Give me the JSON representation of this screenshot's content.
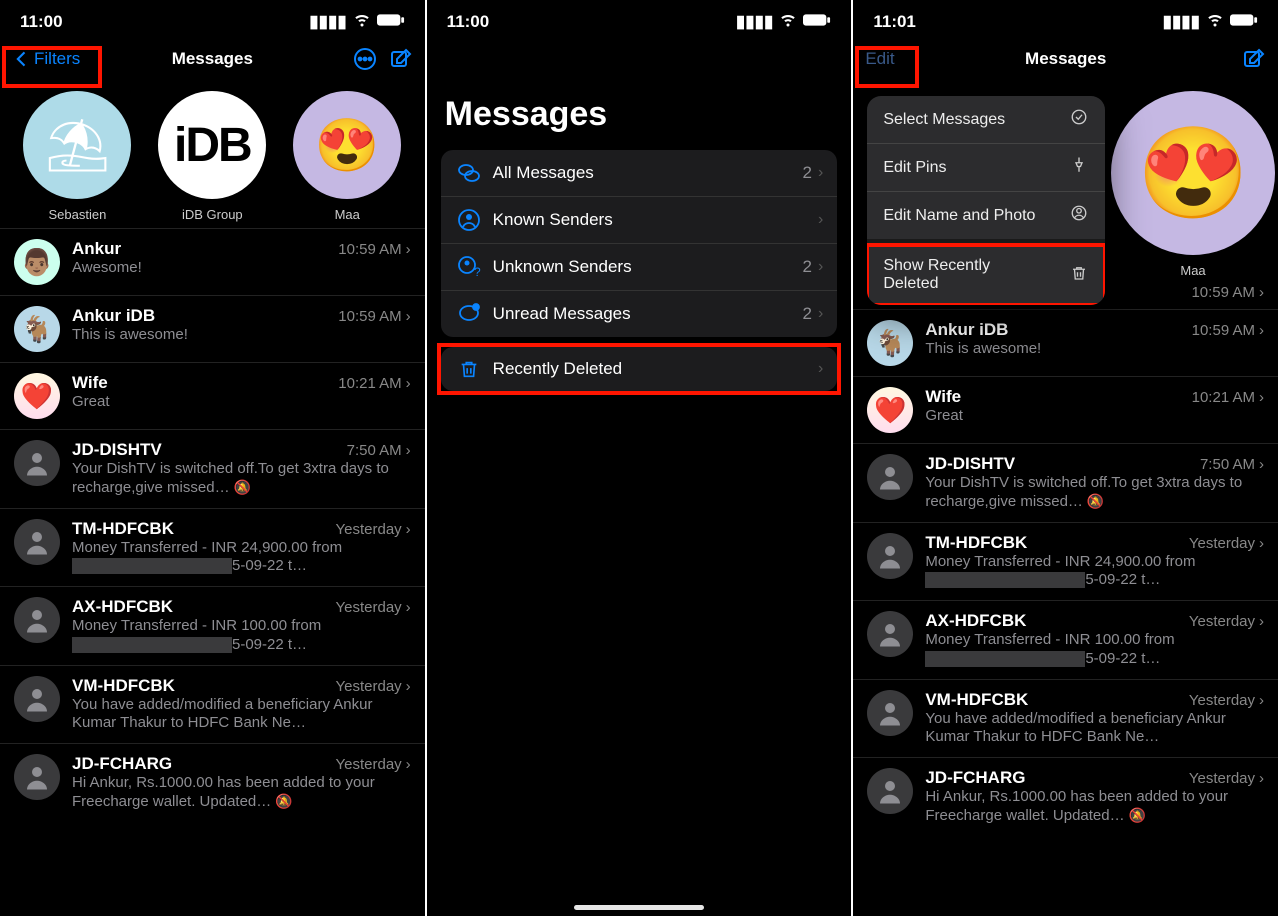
{
  "panel1": {
    "time": "11:00",
    "nav": {
      "back": "Filters",
      "title": "Messages"
    },
    "pins": [
      {
        "name": "Sebastien",
        "emoji": "⛱"
      },
      {
        "name": "iDB Group",
        "emoji": "iDB"
      },
      {
        "name": "Maa",
        "emoji": "😍"
      }
    ],
    "chats": [
      {
        "name": "Ankur",
        "time": "10:59 AM",
        "snippet": "Awesome!",
        "avatar": "👨🏽"
      },
      {
        "name": "Ankur iDB",
        "time": "10:59 AM",
        "snippet": "This is awesome!",
        "avatar": "🐐"
      },
      {
        "name": "Wife",
        "time": "10:21 AM",
        "snippet": "Great",
        "avatar": "❤️"
      },
      {
        "name": "JD-DISHTV",
        "time": "7:50 AM",
        "snippet": "Your DishTV is switched off.To get 3xtra days to recharge,give missed…",
        "muted": true
      },
      {
        "name": "TM-HDFCBK",
        "time": "Yesterday",
        "snippet1": "Money Transferred - INR 24,900.00 from",
        "snippet2": "5-09-22 t…"
      },
      {
        "name": "AX-HDFCBK",
        "time": "Yesterday",
        "snippet1": "Money Transferred - INR 100.00 from",
        "snippet2": "5-09-22 t…"
      },
      {
        "name": "VM-HDFCBK",
        "time": "Yesterday",
        "snippet": "You have added/modified a beneficiary Ankur Kumar Thakur to HDFC Bank Ne…"
      },
      {
        "name": "JD-FCHARG",
        "time": "Yesterday",
        "snippet": "Hi Ankur, Rs.1000.00 has been added to your Freecharge wallet. Updated…",
        "muted": true
      }
    ]
  },
  "panel2": {
    "time": "11:00",
    "title": "Messages",
    "filters": [
      {
        "label": "All Messages",
        "count": "2"
      },
      {
        "label": "Known Senders",
        "count": ""
      },
      {
        "label": "Unknown Senders",
        "count": "2"
      },
      {
        "label": "Unread Messages",
        "count": "2"
      }
    ],
    "recent": {
      "label": "Recently Deleted"
    }
  },
  "panel3": {
    "time": "11:01",
    "nav": {
      "edit": "Edit",
      "title": "Messages"
    },
    "menu": [
      {
        "label": "Select Messages"
      },
      {
        "label": "Edit Pins"
      },
      {
        "label": "Edit Name and Photo"
      },
      {
        "label": "Show Recently Deleted"
      }
    ],
    "pin": {
      "name": "Maa",
      "emoji": "😍"
    },
    "chats_time0": "10:59 AM",
    "chats": [
      {
        "name": "Ankur iDB",
        "time": "10:59 AM",
        "snippet": "This is awesome!",
        "avatar": "🐐"
      },
      {
        "name": "Wife",
        "time": "10:21 AM",
        "snippet": "Great",
        "avatar": "❤️"
      },
      {
        "name": "JD-DISHTV",
        "time": "7:50 AM",
        "snippet": "Your DishTV is switched off.To get 3xtra days to recharge,give missed…",
        "muted": true
      },
      {
        "name": "TM-HDFCBK",
        "time": "Yesterday",
        "snippet1": "Money Transferred - INR 24,900.00 from",
        "snippet2": "5-09-22 t…"
      },
      {
        "name": "AX-HDFCBK",
        "time": "Yesterday",
        "snippet1": "Money Transferred - INR 100.00 from",
        "snippet2": "5-09-22 t…"
      },
      {
        "name": "VM-HDFCBK",
        "time": "Yesterday",
        "snippet": "You have added/modified a beneficiary Ankur Kumar Thakur to HDFC Bank Ne…"
      },
      {
        "name": "JD-FCHARG",
        "time": "Yesterday",
        "snippet": "Hi Ankur, Rs.1000.00 has been added to your Freecharge wallet. Updated…",
        "muted": true
      }
    ]
  }
}
